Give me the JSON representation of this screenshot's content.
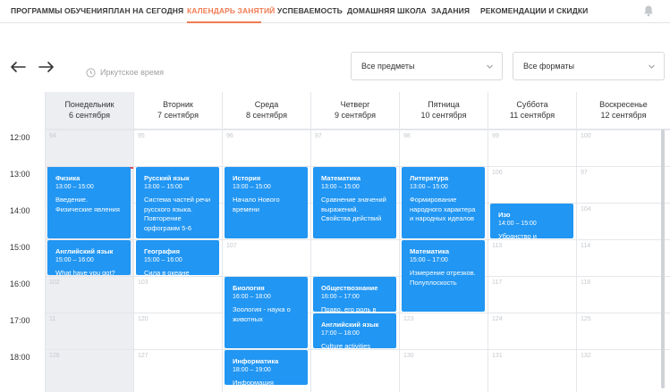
{
  "nav": {
    "items": [
      {
        "label": "ПРОГРАММЫ ОБУЧЕНИЯ",
        "active": false
      },
      {
        "label": "ПЛАН НА СЕГОДНЯ",
        "active": false
      },
      {
        "label": "КАЛЕНДАРЬ ЗАНЯТИЙ",
        "active": true
      },
      {
        "label": "УСПЕВАЕМОСТЬ",
        "active": false
      },
      {
        "label": "ДОМАШНЯЯ ШКОЛА",
        "active": false
      },
      {
        "label": "ЗАДАНИЯ",
        "active": false
      },
      {
        "label": "РЕКОМЕНДАЦИИ И СКИДКИ",
        "active": false
      }
    ],
    "accent_color": "#f07c54",
    "bell_icon": "bell-icon"
  },
  "controls": {
    "prev_icon": "arrow-left-icon",
    "next_icon": "arrow-right-icon",
    "timezone_label": "Иркутское время",
    "subjects_select": "Все предметы",
    "formats_select": "Все форматы"
  },
  "calendar": {
    "days": [
      {
        "name": "Понедельник",
        "date": "6 сентября",
        "today": true
      },
      {
        "name": "Вторник",
        "date": "7 сентября",
        "today": false
      },
      {
        "name": "Среда",
        "date": "8 сентября",
        "today": false
      },
      {
        "name": "Четверг",
        "date": "9 сентября",
        "today": false
      },
      {
        "name": "Пятница",
        "date": "10 сентября",
        "today": false
      },
      {
        "name": "Суббота",
        "date": "11 сентября",
        "today": false
      },
      {
        "name": "Воскресенье",
        "date": "12 сентября",
        "today": false
      }
    ],
    "hours": [
      "12:00",
      "13:00",
      "14:00",
      "15:00",
      "16:00",
      "17:00",
      "18:00"
    ],
    "event_color": "#2196f3",
    "events": [
      {
        "day": 0,
        "start": 13,
        "end": 15,
        "title": "Физика",
        "time": "13:00 – 15:00",
        "desc": "Введение. Физические явления"
      },
      {
        "day": 0,
        "start": 15,
        "end": 16,
        "title": "Английский язык",
        "time": "15:00 – 16:00",
        "desc": "What have you got?"
      },
      {
        "day": 1,
        "start": 13,
        "end": 15,
        "title": "Русский язык",
        "time": "13:00 – 15:00",
        "desc": "Система частей речи русского языка. Повторение орфограмм 5-6"
      },
      {
        "day": 1,
        "start": 15,
        "end": 16,
        "title": "География",
        "time": "15:00 – 16:00",
        "desc": "Сила в океане"
      },
      {
        "day": 2,
        "start": 13,
        "end": 15,
        "title": "История",
        "time": "13:00 – 15:00",
        "desc": "Начало Нового времени"
      },
      {
        "day": 2,
        "start": 16,
        "end": 18,
        "title": "Биология",
        "time": "16:00 – 18:00",
        "desc": "Зоология - наука о животных"
      },
      {
        "day": 2,
        "start": 18,
        "end": 19,
        "title": "Информатика",
        "time": "18:00 – 19:00",
        "desc": "Информация"
      },
      {
        "day": 3,
        "start": 13,
        "end": 15,
        "title": "Математика",
        "time": "13:00 – 15:00",
        "desc": "Сравнение значений выражений. Свойства действий"
      },
      {
        "day": 3,
        "start": 16,
        "end": 17,
        "title": "Обществознание",
        "time": "16:00 – 17:00",
        "desc": "Право, его роль в"
      },
      {
        "day": 3,
        "start": 17,
        "end": 18,
        "title": "Английский язык",
        "time": "17:00 – 18:00",
        "desc": "Culture activities"
      },
      {
        "day": 4,
        "start": 13,
        "end": 15,
        "title": "Литература",
        "time": "13:00 – 15:00",
        "desc": "Формирование народного характера и народных идеалов"
      },
      {
        "day": 4,
        "start": 15,
        "end": 17,
        "title": "Математика",
        "time": "15:00 – 17:00",
        "desc": "Измерение отрезков. Полуплоскость"
      },
      {
        "day": 5,
        "start": 14,
        "end": 15,
        "title": "Изо",
        "time": "14:00 – 15:00",
        "desc": "Убранство и"
      }
    ],
    "cell_numbers": {
      "0": [
        {
          "hour": 12,
          "label": "94"
        },
        {
          "hour": 16,
          "label": "102"
        },
        {
          "hour": 17,
          "label": "11"
        },
        {
          "hour": 18,
          "label": "126"
        }
      ],
      "1": [
        {
          "hour": 12,
          "label": "95"
        },
        {
          "hour": 16,
          "label": "103"
        },
        {
          "hour": 17,
          "label": "120"
        },
        {
          "hour": 18,
          "label": "127"
        }
      ],
      "2": [
        {
          "hour": 12,
          "label": "96"
        },
        {
          "hour": 15,
          "label": "107"
        }
      ],
      "3": [
        {
          "hour": 12,
          "label": "97"
        }
      ],
      "4": [
        {
          "hour": 12,
          "label": "98"
        },
        {
          "hour": 17,
          "label": "123"
        },
        {
          "hour": 18,
          "label": "130"
        }
      ],
      "5": [
        {
          "hour": 12,
          "label": "99"
        },
        {
          "hour": 13,
          "label": "106"
        },
        {
          "hour": 15,
          "label": "113"
        },
        {
          "hour": 16,
          "label": "117"
        },
        {
          "hour": 17,
          "label": "124"
        },
        {
          "hour": 18,
          "label": "131"
        }
      ],
      "6": [
        {
          "hour": 12,
          "label": "100"
        },
        {
          "hour": 13,
          "label": "97"
        },
        {
          "hour": 14,
          "label": "104"
        },
        {
          "hour": 15,
          "label": "114"
        },
        {
          "hour": 16,
          "label": "118"
        },
        {
          "hour": 17,
          "label": "125"
        },
        {
          "hour": 18,
          "label": "132"
        }
      ]
    }
  }
}
